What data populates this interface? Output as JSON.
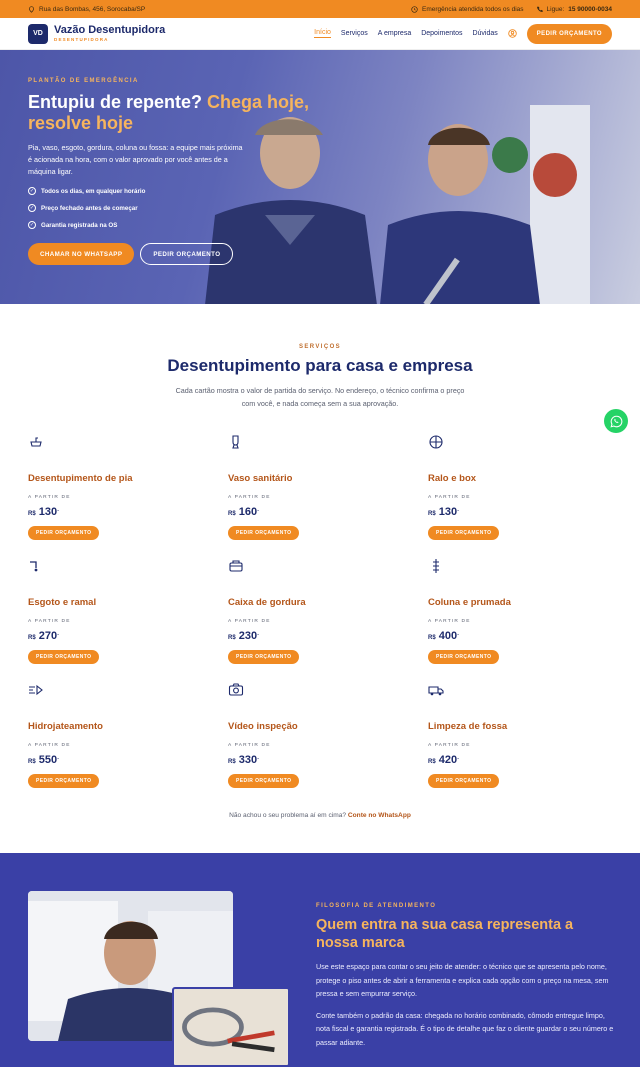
{
  "topbar": {
    "address": "Rua das Bombas, 456, Sorocaba/SP",
    "hours": "Emergência atendida todos os dias",
    "call_label": "Ligue:",
    "phone": "15 90000-0034"
  },
  "brand": {
    "monogram": "VD",
    "name": "Vazão Desentupidora",
    "sub": "DESENTUPIDORA"
  },
  "menu": {
    "items": [
      "Início",
      "Serviços",
      "A empresa",
      "Depoimentos",
      "Dúvidas"
    ],
    "cta": "PEDIR ORÇAMENTO"
  },
  "hero": {
    "eyebrow": "PLANTÃO DE EMERGÊNCIA",
    "title_a": "Entupiu de repente?",
    "title_b": "Chega hoje, resolve hoje",
    "body": "Pia, vaso, esgoto, gordura, coluna ou fossa: a equipe mais próxima é acionada na hora, com o valor aprovado por você antes de a máquina ligar.",
    "checks": [
      "Todos os dias, em qualquer horário",
      "Preço fechado antes de começar",
      "Garantia registrada na OS"
    ],
    "btn_whatsapp": "CHAMAR NO WHATSAPP",
    "btn_quote": "PEDIR ORÇAMENTO"
  },
  "services": {
    "eyebrow": "SERVIÇOS",
    "title": "Desentupimento para casa e empresa",
    "lead_1": "Cada cartão mostra o valor de partida do serviço. No endereço, o técnico confirma o preço",
    "lead_2": "com você, e nada começa sem a sua aprovação.",
    "from": "A PARTIR DE",
    "currency": "R$",
    "cta": "PEDIR ORÇAMENTO",
    "items": [
      {
        "name": "Desentupimento de pia",
        "price": "130",
        "icon": "sink-icon"
      },
      {
        "name": "Vaso sanitário",
        "price": "160",
        "icon": "toilet-icon"
      },
      {
        "name": "Ralo e box",
        "price": "130",
        "icon": "drain-icon"
      },
      {
        "name": "Esgoto e ramal",
        "price": "270",
        "icon": "pipe-icon"
      },
      {
        "name": "Caixa de gordura",
        "price": "230",
        "icon": "box-icon"
      },
      {
        "name": "Coluna e prumada",
        "price": "400",
        "icon": "column-icon"
      },
      {
        "name": "Hidrojateamento",
        "price": "550",
        "icon": "water-jet-icon"
      },
      {
        "name": "Vídeo inspeção",
        "price": "330",
        "icon": "camera-icon"
      },
      {
        "name": "Limpeza de fossa",
        "price": "420",
        "icon": "truck-icon"
      }
    ],
    "note": "Não achou o seu problema aí em cima?",
    "note_link": "Conte no WhatsApp"
  },
  "about": {
    "eyebrow": "FILOSOFIA DE ATENDIMENTO",
    "title": "Quem entra na sua casa representa a nossa marca",
    "p1": "Use este espaço para contar o seu jeito de atender: o técnico que se apresenta pelo nome, protege o piso antes de abrir a ferramenta e explica cada opção com o preço na mesa, sem pressa e sem empurrar serviço.",
    "p2": "Conte também o padrão da casa: chegada no horário combinado, cômodo entregue limpo, nota fiscal e garantia registrada. É o tipo de detalhe que faz o cliente guardar o seu número e passar adiante."
  }
}
